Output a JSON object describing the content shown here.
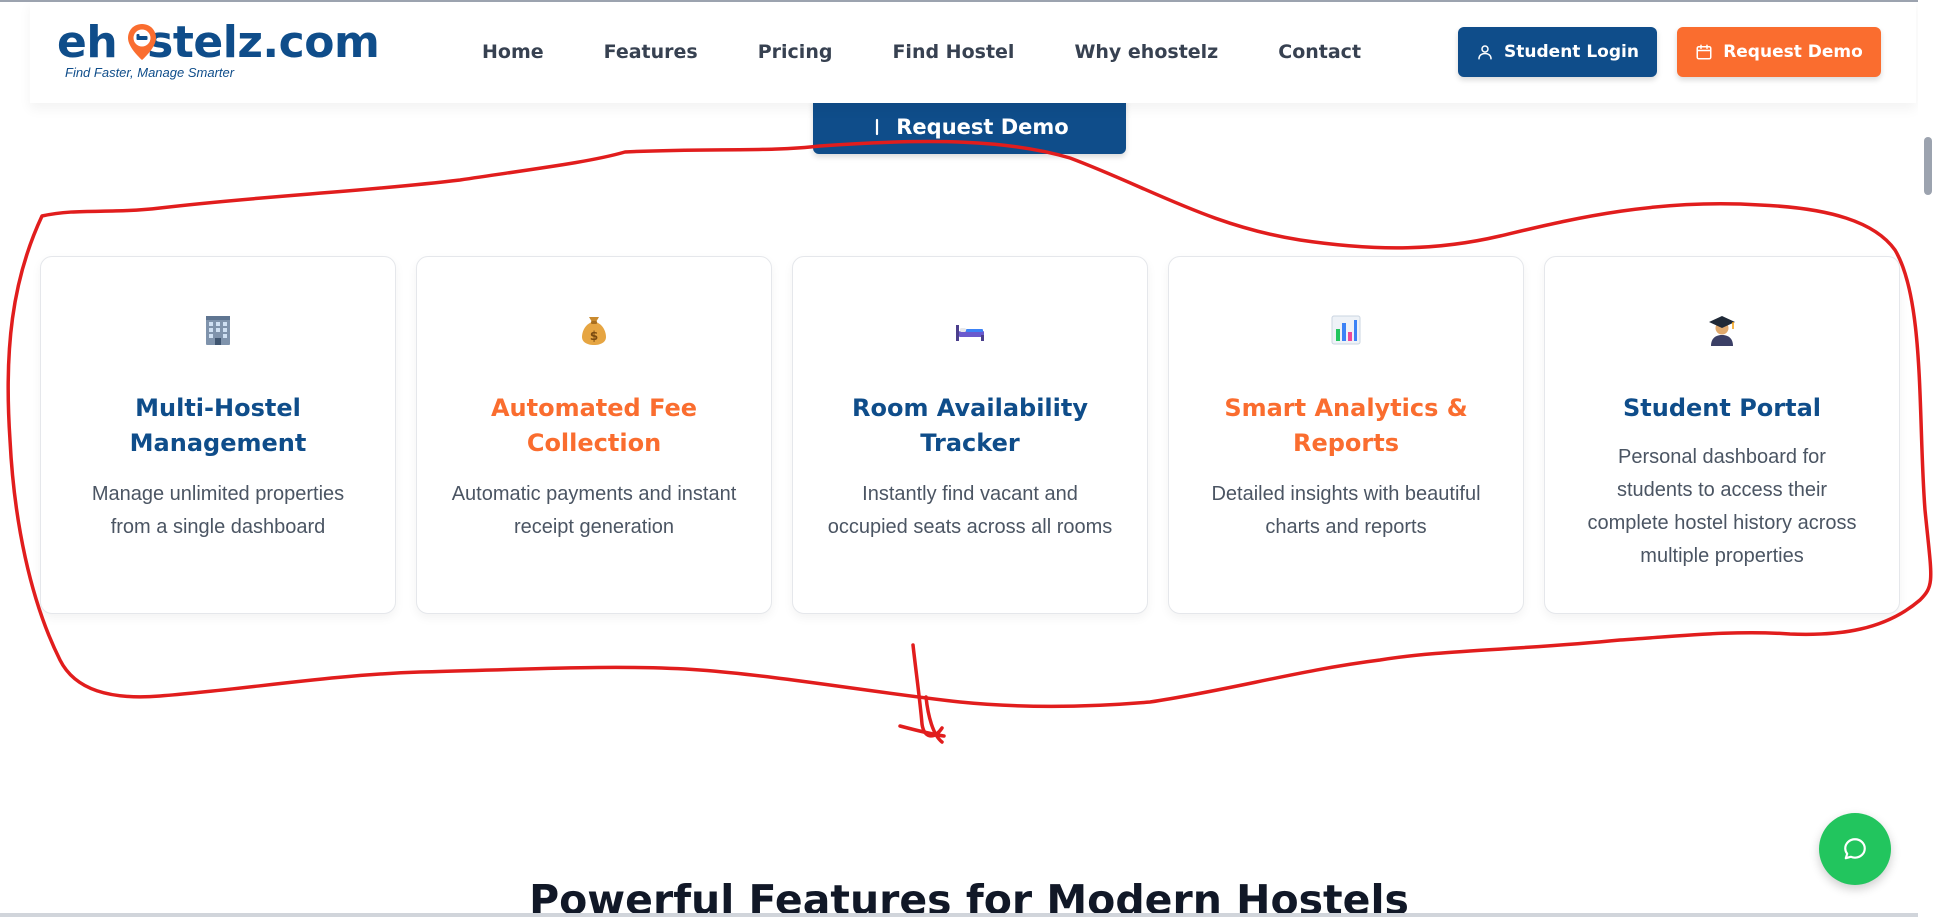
{
  "brand": {
    "name_left": "eh",
    "name_right": "stelz.com",
    "tagline": "Find Faster, Manage Smarter",
    "color_primary": "#0f4d8a",
    "color_accent": "#fa6d2f"
  },
  "nav": {
    "items": [
      {
        "label": "Home"
      },
      {
        "label": "Features"
      },
      {
        "label": "Pricing"
      },
      {
        "label": "Find Hostel"
      },
      {
        "label": "Why ehostelz"
      },
      {
        "label": "Contact"
      }
    ]
  },
  "header_buttons": {
    "login_label": "Student Login",
    "login_icon": "user-icon",
    "demo_label": "Request Demo",
    "demo_icon": "calendar-icon"
  },
  "hero": {
    "cta_label": "Request Demo"
  },
  "features": [
    {
      "icon": "office-building-icon",
      "title": "Multi-Hostel Management",
      "description": "Manage unlimited properties from a single dashboard",
      "color": "#0f4d8a"
    },
    {
      "icon": "money-bag-icon",
      "title": "Automated Fee Collection",
      "description": "Automatic payments and instant receipt generation",
      "color": "#fa6d2f"
    },
    {
      "icon": "bed-icon",
      "title": "Room Availability Tracker",
      "description": "Instantly find vacant and occupied seats across all rooms",
      "color": "#0f4d8a"
    },
    {
      "icon": "bar-chart-icon",
      "title": "Smart Analytics & Reports",
      "description": "Detailed insights with beautiful charts and reports",
      "color": "#fa6d2f"
    },
    {
      "icon": "graduate-icon",
      "title": "Student Portal",
      "description": "Personal dashboard for students to access their complete hostel history across multiple properties",
      "color": "#0f4d8a"
    }
  ],
  "section": {
    "heading": "Powerful Features for Modern Hostels"
  },
  "chat": {
    "icon": "chat-bubble-icon",
    "color": "#22c55e"
  },
  "annotation": {
    "color": "#e11d1d"
  }
}
